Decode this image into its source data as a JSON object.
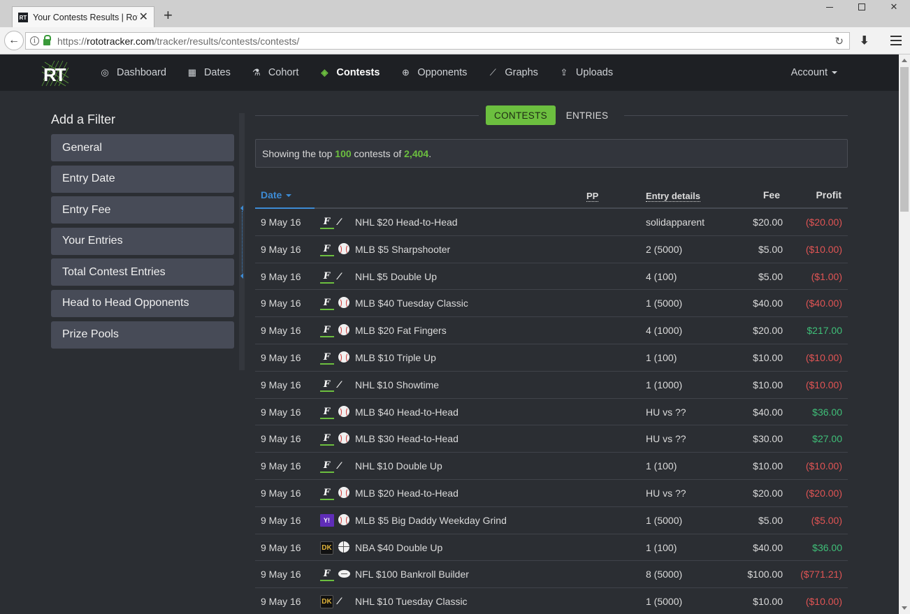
{
  "browser": {
    "tab_title": "Your Contests Results | RotoTracker",
    "favicon_text": "RT",
    "new_tab_label": "+",
    "url_scheme": "https://",
    "url_host": "rototracker.com",
    "url_path": "/tracker/results/contests/contests/"
  },
  "app": {
    "logo_text": "RT",
    "nav": [
      {
        "label": "Dashboard",
        "icon": "compass-icon",
        "glyph": "◎",
        "active": false
      },
      {
        "label": "Dates",
        "icon": "calendar-icon",
        "glyph": "▦",
        "active": false
      },
      {
        "label": "Cohort",
        "icon": "flask-icon",
        "glyph": "⚗",
        "active": false
      },
      {
        "label": "Contests",
        "icon": "ticket-icon",
        "glyph": "◈",
        "active": true
      },
      {
        "label": "Opponents",
        "icon": "crosshair-icon",
        "glyph": "⊕",
        "active": false
      },
      {
        "label": "Graphs",
        "icon": "line-chart-icon",
        "glyph": "⟋",
        "active": false
      },
      {
        "label": "Uploads",
        "icon": "upload-icon",
        "glyph": "⇪",
        "active": false
      }
    ],
    "account_label": "Account",
    "accent_color": "#6cbf3f",
    "link_color": "#3d8bd4"
  },
  "sidebar": {
    "title": "Add a Filter",
    "filters": [
      "General",
      "Entry Date",
      "Entry Fee",
      "Your Entries",
      "Total Contest Entries",
      "Head to Head Opponents",
      "Prize Pools"
    ]
  },
  "main": {
    "tabs": {
      "contests": "CONTESTS",
      "entries": "ENTRIES"
    },
    "summary": {
      "prefix": "Showing the top ",
      "top": "100",
      "middle": " contests of ",
      "total": "2,404",
      "suffix": "."
    },
    "columns": {
      "date": "Date",
      "pp": "PP",
      "entry_details": "Entry details",
      "fee": "Fee",
      "profit": "Profit"
    },
    "rows": [
      {
        "date": "9 May 16",
        "site": "fanduel",
        "sport": "nhl",
        "name": "NHL $20 Head-to-Head",
        "entry": "solidapparent",
        "fee": "$20.00",
        "profit": "($20.00)",
        "positive": false
      },
      {
        "date": "9 May 16",
        "site": "fanduel",
        "sport": "mlb",
        "name": "MLB $5 Sharpshooter",
        "entry": "2 (5000)",
        "fee": "$5.00",
        "profit": "($10.00)",
        "positive": false
      },
      {
        "date": "9 May 16",
        "site": "fanduel",
        "sport": "nhl",
        "name": "NHL $5 Double Up",
        "entry": "4 (100)",
        "fee": "$5.00",
        "profit": "($1.00)",
        "positive": false
      },
      {
        "date": "9 May 16",
        "site": "fanduel",
        "sport": "mlb",
        "name": "MLB $40 Tuesday Classic",
        "entry": "1 (5000)",
        "fee": "$40.00",
        "profit": "($40.00)",
        "positive": false
      },
      {
        "date": "9 May 16",
        "site": "fanduel",
        "sport": "mlb",
        "name": "MLB $20 Fat Fingers",
        "entry": "4 (1000)",
        "fee": "$20.00",
        "profit": "$217.00",
        "positive": true
      },
      {
        "date": "9 May 16",
        "site": "fanduel",
        "sport": "mlb",
        "name": "MLB $10 Triple Up",
        "entry": "1 (100)",
        "fee": "$10.00",
        "profit": "($10.00)",
        "positive": false
      },
      {
        "date": "9 May 16",
        "site": "fanduel",
        "sport": "nhl",
        "name": "NHL $10 Showtime",
        "entry": "1 (1000)",
        "fee": "$10.00",
        "profit": "($10.00)",
        "positive": false
      },
      {
        "date": "9 May 16",
        "site": "fanduel",
        "sport": "mlb",
        "name": "MLB $40 Head-to-Head",
        "entry": "HU vs ??",
        "fee": "$40.00",
        "profit": "$36.00",
        "positive": true
      },
      {
        "date": "9 May 16",
        "site": "fanduel",
        "sport": "mlb",
        "name": "MLB $30 Head-to-Head",
        "entry": "HU vs ??",
        "fee": "$30.00",
        "profit": "$27.00",
        "positive": true
      },
      {
        "date": "9 May 16",
        "site": "fanduel",
        "sport": "nhl",
        "name": "NHL $10 Double Up",
        "entry": "1 (100)",
        "fee": "$10.00",
        "profit": "($10.00)",
        "positive": false
      },
      {
        "date": "9 May 16",
        "site": "fanduel",
        "sport": "mlb",
        "name": "MLB $20 Head-to-Head",
        "entry": "HU vs ??",
        "fee": "$20.00",
        "profit": "($20.00)",
        "positive": false
      },
      {
        "date": "9 May 16",
        "site": "yahoo",
        "sport": "mlb",
        "name": "MLB $5 Big Daddy Weekday Grind",
        "entry": "1 (5000)",
        "fee": "$5.00",
        "profit": "($5.00)",
        "positive": false
      },
      {
        "date": "9 May 16",
        "site": "draftkings",
        "sport": "nba",
        "name": "NBA $40 Double Up",
        "entry": "1 (100)",
        "fee": "$40.00",
        "profit": "$36.00",
        "positive": true
      },
      {
        "date": "9 May 16",
        "site": "fanduel",
        "sport": "nfl",
        "name": "NFL $100 Bankroll Builder",
        "entry": "8 (5000)",
        "fee": "$100.00",
        "profit": "($771.21)",
        "positive": false
      },
      {
        "date": "9 May 16",
        "site": "draftkings",
        "sport": "nhl",
        "name": "NHL $10 Tuesday Classic",
        "entry": "1 (5000)",
        "fee": "$10.00",
        "profit": "($10.00)",
        "positive": false
      }
    ]
  }
}
